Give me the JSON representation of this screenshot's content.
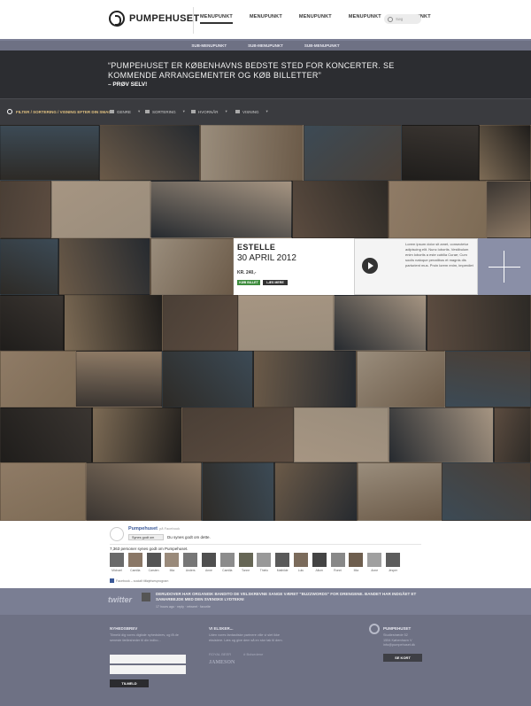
{
  "header": {
    "logo_text": "PUMPEHUSET",
    "nav": [
      "MENUPUNKT",
      "MENUPUNKT",
      "MENUPUNKT",
      "MENUPUNKT",
      "MENUPUNKT"
    ],
    "search_placeholder": "Søg"
  },
  "subnav": [
    "SUB-MENUPUNKT",
    "SUB-MENUPUNKT",
    "SUB-MENUPUNKT"
  ],
  "hero": {
    "quote": "“PUMPEHUSET ER KØBENHAVNS BEDSTE STED FOR KONCERTER. SE KOMMENDE ARRANGEMENTER OG KØB BILLETTER”",
    "sub": "– PRØV SELV!"
  },
  "filter": {
    "label": "FILTER / SORTERING / VISNING EFTER DIN SMAG",
    "dropdowns": [
      "GENRE",
      "SORTERING",
      "HVORNÅR",
      "VISNING"
    ]
  },
  "event": {
    "name": "ESTELLE",
    "date": "30 APRIL 2012",
    "price": "KR. 240,-",
    "buy": "KØB BILLET",
    "more": "LÆS MERE",
    "description": "Lorem ipsum dolor sit amet, consectetur adipiscing elit. Nunc lobortis. Vestibulum enim lobortis a este cubilia Curae; Cum sociis natoque penatibus et magnis dis parturient mus. Proin lorem enim, imperdiet"
  },
  "facebook": {
    "page": "Pumpehuset",
    "on": "på Facebook",
    "like_button": "Synes godt om",
    "you_like": "Du synes godt om dette.",
    "count_text": "7,363 personer synes godt om Pumpehuset.",
    "faces": [
      "Michael",
      "Camilla",
      "Carsten",
      "Mia",
      "Anders",
      "Anne",
      "Camilla",
      "Tonne",
      "Thielo",
      "Mathilde",
      "Lulu",
      "Allum",
      "Ronni",
      "Mia",
      "Anne",
      "Jesper"
    ],
    "plugin": "Facebook – socialt tilføjelsesprogram"
  },
  "twitter": {
    "logo": "twitter",
    "text": "DERUDOVER HAR ORGANISK BANDITO DE VELSKREVNE SANGE VÆRET \"BUZZWORDS\" FOR DRENGENE. BANDET HAR INDGÅET ET SAMARBEJDE MED DEN SVENSKE LYDTEKNI",
    "meta": "17 hours ago · reply · retweet · favorite"
  },
  "footer": {
    "newsletter_heading": "NYHEDSBREV",
    "newsletter_text": "Tilmeld dig vores digitale nyhedsbrev, og få de seneste fællesheder til din indbo...",
    "subscribe": "TILMELD",
    "love_heading": "VI ELSKER...",
    "love_text": "Uden vores fantastiske partnere ville vi slet ikke eksistere. Læs og give dem så en stor tak til dem.",
    "love_logos": [
      "ROYAL BEER",
      "# Bolsedene"
    ],
    "jameson": "JAMESON",
    "contact_name": "PUMPEHUSET",
    "contact_lines": [
      "Studiestræde 52",
      "1554 København V",
      "info@pumpehuset.dk"
    ],
    "map_button": "SE KORT"
  },
  "colors": {
    "header_bg": "#ffffff",
    "hero_bg": "#2c2d31",
    "filter_bg": "#3a3b3f",
    "footer_bg": "#6e7184",
    "buy_green": "#3e8c3e"
  }
}
